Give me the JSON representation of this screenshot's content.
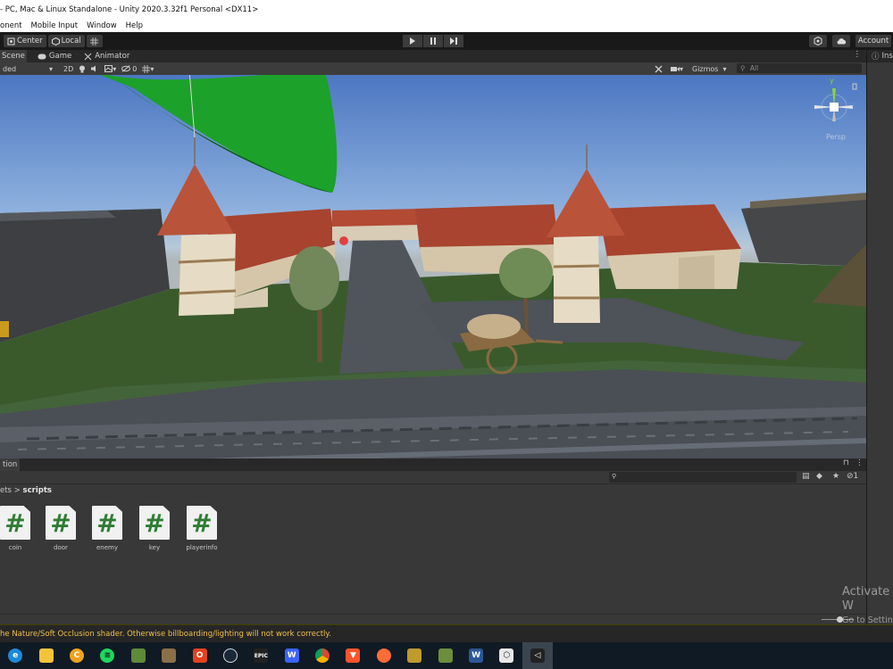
{
  "window": {
    "title": "- PC, Mac & Linux Standalone - Unity 2020.3.32f1 Personal <DX11>"
  },
  "menu": [
    "onent",
    "Mobile Input",
    "Window",
    "Help"
  ],
  "toolbar": {
    "pivot_label": "Center",
    "space_label": "Local",
    "account_label": "Account"
  },
  "tabs": {
    "scene": "Scene",
    "game": "Game",
    "animator": "Animator"
  },
  "scene_toolbar": {
    "shading_mode": "ded",
    "mode_2d": "2D",
    "hidden_count": "0",
    "gizmos": "Gizmos",
    "search_placeholder": "All"
  },
  "gizmo": {
    "persp_label": "Persp",
    "axis_y": "y",
    "axis_z": "z"
  },
  "inspector": {
    "tab_label": "Insp"
  },
  "project": {
    "tab_label": "tion",
    "breadcrumb_parent": "ets",
    "breadcrumb_current": "scripts",
    "hidden_count": "1",
    "assets": [
      {
        "name": "coin",
        "glyph": "#"
      },
      {
        "name": "door",
        "glyph": "#"
      },
      {
        "name": "enemy",
        "glyph": "#"
      },
      {
        "name": "key",
        "glyph": "#"
      },
      {
        "name": "playerinfo",
        "glyph": "#"
      }
    ]
  },
  "status": {
    "message": "he Nature/Soft Occlusion shader. Otherwise billboarding/lighting will not work correctly."
  },
  "watermark": {
    "line1": "Activate W",
    "line2": "Go to Settin"
  },
  "colors": {
    "accent_green": "#2f7d34",
    "warning": "#f0c04a",
    "sky_top": "#4c77c2"
  },
  "taskbar_icons": [
    "edge-icon",
    "file-explorer-icon",
    "coin-app-icon",
    "spotify-icon",
    "minecraft-icon",
    "photo-icon",
    "office-icon",
    "steam-icon",
    "epic-games-icon",
    "wondershare-icon",
    "chrome-icon",
    "brave-icon",
    "postman-icon",
    "app-icon",
    "minecraft-launcher-icon",
    "word-icon",
    "unity-hub-icon",
    "unity-icon"
  ]
}
